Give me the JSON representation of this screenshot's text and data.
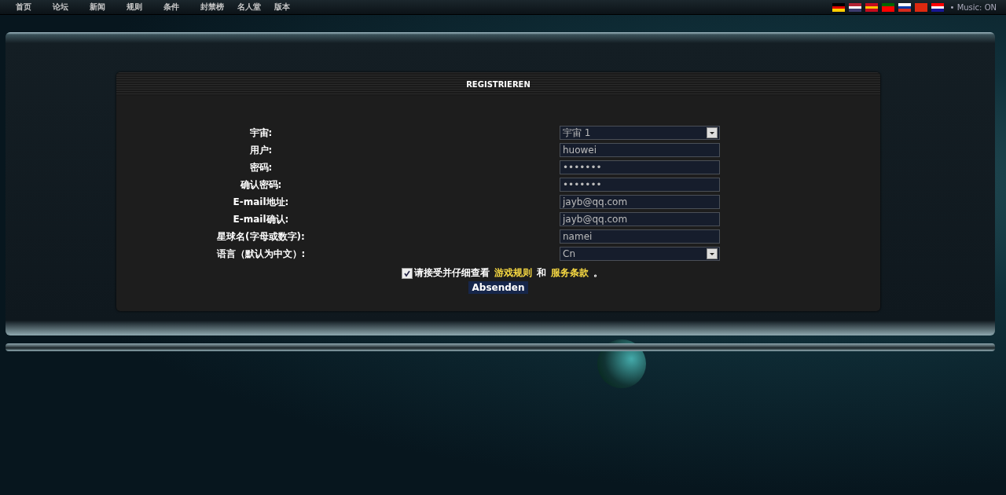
{
  "nav": {
    "items": [
      {
        "label": "首页"
      },
      {
        "label": "论坛"
      },
      {
        "label": "新闻"
      },
      {
        "label": "规则"
      },
      {
        "label": "条件"
      },
      {
        "label": "封禁榜"
      },
      {
        "label": "名人堂"
      },
      {
        "label": "版本"
      }
    ],
    "languages": [
      {
        "kind": "de"
      },
      {
        "kind": "us"
      },
      {
        "kind": "es"
      },
      {
        "kind": "pt"
      },
      {
        "kind": "ru"
      },
      {
        "kind": "cn"
      },
      {
        "kind": "hr"
      }
    ],
    "music": "• Music: ON"
  },
  "form": {
    "title": "REGISTRIEREN",
    "fields": [
      {
        "label": "宇宙:",
        "kind": "select",
        "value": "宇宙  1"
      },
      {
        "label": "用户:",
        "kind": "text",
        "value": "huowei"
      },
      {
        "label": "密码:",
        "kind": "text",
        "value": "•••••••"
      },
      {
        "label": "确认密码:",
        "kind": "text",
        "value": "•••••••"
      },
      {
        "label": "E-mail地址:",
        "kind": "text",
        "value": "jayb@qq.com"
      },
      {
        "label": "E-mail确认:",
        "kind": "text",
        "value": "jayb@qq.com"
      },
      {
        "label": "星球名(字母或数字):",
        "kind": "text",
        "value": "namei"
      },
      {
        "label": "语言（默认为中文）:",
        "kind": "select",
        "value": "Cn"
      }
    ],
    "terms": {
      "checked": true,
      "text": "请接受并仔细查看",
      "link_1": "游戏规则",
      "joiner": "和",
      "link_2": "服务条款",
      "end": "。"
    },
    "submit": "Absenden"
  }
}
